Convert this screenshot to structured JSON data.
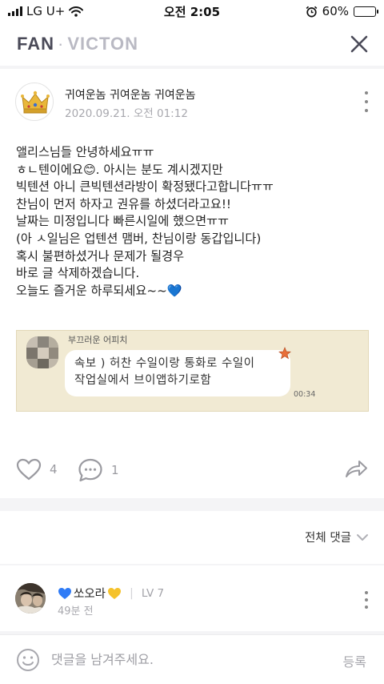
{
  "status_bar": {
    "carrier": "LG U+",
    "time": "오전 2:05",
    "battery": "60%",
    "battery_level": 0.6
  },
  "header": {
    "fan_label": "FAN",
    "separator": "·",
    "artist": "VICTON"
  },
  "post": {
    "author": "귀여운놈 귀여운놈 귀여운놈",
    "date": "2020.09.21. 오전 01:12",
    "body_lines": [
      "앨리스님들 안녕하세요ㅠㅠ",
      "ㅎㄴ텐이에요😊. 아시는 분도 계시겠지만",
      "빅텐션 아니 큰빅텐션라방이 확정됐다고합니다ㅠㅠ",
      "찬님이 먼저 하자고 권유를 하셨더라고요!!",
      "날짜는 미정입니다 빠른시일에 했으면ㅠㅠ",
      "(아 ㅅ일님은 업텐션 맴버, 찬님이랑 동갑입니다)",
      "혹시 불편하셨거나 문제가 될경우",
      "바로 글 삭제하겠습니다.",
      "오늘도 즐거운 하루되세요~~💙"
    ],
    "image": {
      "sender_name": "부끄러운 어피치",
      "message_line1": "속보 ) 허찬 수일이랑 통화로 수일이",
      "message_line2": "작업실에서 브이앱하기로함",
      "time": "00:34"
    },
    "likes": "4",
    "comments_count": "1"
  },
  "comments_section": {
    "sort_label": "전체 댓글"
  },
  "comment": {
    "name": "쏘오라",
    "level": "LV 7",
    "time": "49분 전"
  },
  "input_bar": {
    "placeholder": "댓글을 남겨주세요.",
    "submit_label": "등록"
  },
  "colors": {
    "accent_blue": "#2f7bf6",
    "heart_yellow": "#f5c22b",
    "header_text": "#4a4a58",
    "muted": "#a8a8ae",
    "chat_background": "#f1ead3"
  }
}
